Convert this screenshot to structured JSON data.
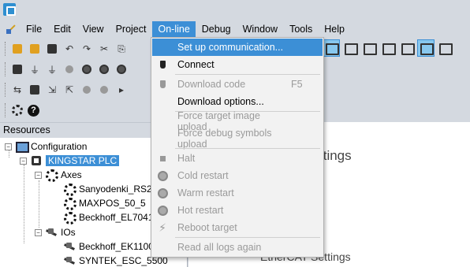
{
  "menubar": {
    "items": [
      "File",
      "Edit",
      "View",
      "Project",
      "On-line",
      "Debug",
      "Window",
      "Tools",
      "Help"
    ]
  },
  "panel": {
    "header": "Resources"
  },
  "tree": {
    "configuration": "Configuration",
    "plc": "KINGSTAR PLC",
    "axes": "Axes",
    "axis_items": [
      "Sanyodenki_RS2",
      "MAXPOS_50_5",
      "Beckhoff_EL7041"
    ],
    "ios": "IOs",
    "io_items": [
      "Beckhoff_EK1100",
      "SYNTEK_ESC_5500"
    ]
  },
  "main": {
    "title1": "ttings",
    "title2": "EtherCAT Settings"
  },
  "online_menu": {
    "items": [
      {
        "label": "Set up communication...",
        "shortcut": "",
        "icon": "none",
        "state": "highlighted"
      },
      {
        "label": "Connect",
        "shortcut": "",
        "icon": "plug-icon",
        "state": "enabled"
      },
      {
        "label": "Download code",
        "shortcut": "F5",
        "icon": "plug-download-icon",
        "state": "disabled"
      },
      {
        "label": "Download options...",
        "shortcut": "",
        "icon": "none",
        "state": "enabled"
      },
      {
        "label": "Force target image upload",
        "shortcut": "",
        "icon": "none",
        "state": "disabled"
      },
      {
        "label": "Force debug symbols upload",
        "shortcut": "",
        "icon": "none",
        "state": "disabled"
      },
      {
        "label": "Halt",
        "shortcut": "",
        "icon": "stop-square-icon",
        "state": "disabled"
      },
      {
        "label": "Cold restart",
        "shortcut": "",
        "icon": "cold-restart-icon",
        "state": "disabled"
      },
      {
        "label": "Warm restart",
        "shortcut": "",
        "icon": "warm-restart-icon",
        "state": "disabled"
      },
      {
        "label": "Hot restart",
        "shortcut": "",
        "icon": "hot-restart-icon",
        "state": "disabled"
      },
      {
        "label": "Reboot target",
        "shortcut": "",
        "icon": "lightning-icon",
        "state": "disabled"
      },
      {
        "label": "Read all logs again",
        "shortcut": "",
        "icon": "none",
        "state": "disabled"
      }
    ]
  },
  "colors": {
    "accent": "#3c8fd6",
    "disabled_text": "#9a9a9a",
    "chrome": "#d4d9e0"
  }
}
